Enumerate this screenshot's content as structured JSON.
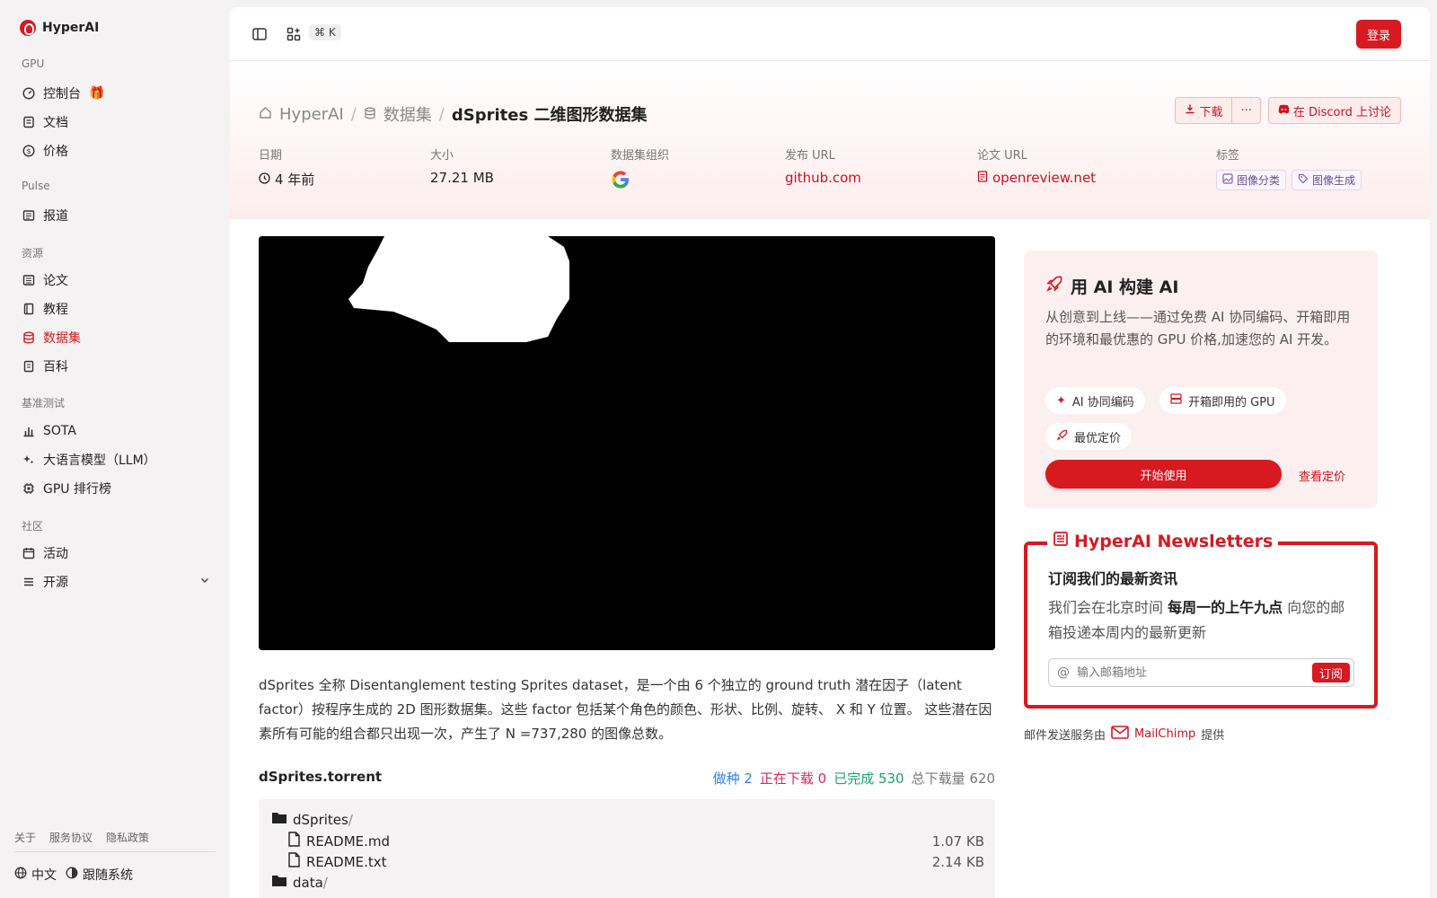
{
  "brand": {
    "name": "HyperAI"
  },
  "sidebar": {
    "sections": [
      {
        "label": "GPU"
      },
      {
        "label": "Pulse"
      },
      {
        "label": "资源"
      },
      {
        "label": "基准测试"
      },
      {
        "label": "社区"
      }
    ],
    "items": [
      {
        "label": "控制台"
      },
      {
        "label": "文档"
      },
      {
        "label": "价格"
      },
      {
        "label": "报道"
      },
      {
        "label": "论文"
      },
      {
        "label": "教程"
      },
      {
        "label": "数据集"
      },
      {
        "label": "百科"
      },
      {
        "label": "SOTA"
      },
      {
        "label": "大语言模型（LLM）"
      },
      {
        "label": "GPU 排行榜"
      },
      {
        "label": "活动"
      },
      {
        "label": "开源"
      }
    ],
    "footer_links": [
      "关于",
      "服务协议",
      "隐私政策"
    ],
    "language": "中文",
    "tracking": "跟随系统"
  },
  "topbar": {
    "shortcut": "⌘ K",
    "login": "登录"
  },
  "breadcrumb": {
    "home": "HyperAI",
    "section": "数据集",
    "current": "dSprites 二维图形数据集"
  },
  "actions": {
    "download": "下载",
    "more": "···",
    "discord": "在 Discord 上讨论"
  },
  "meta": {
    "date_label": "日期",
    "date_value": "4 年前",
    "size_label": "大小",
    "size_value": "27.21 MB",
    "org_label": "数据集组织",
    "release_label": "发布 URL",
    "release_value": "github.com",
    "paper_label": "论文 URL",
    "paper_value": "openreview.net",
    "tags_label": "标签",
    "tags": [
      "图像分类",
      "图像生成"
    ]
  },
  "description": "dSprites 全称 Disentanglement testing Sprites dataset，是一个由 6 个独立的 ground truth 潜在因子（latent factor）按程序生成的 2D 图形数据集。这些 factor 包括某个角色的颜色、形状、比例、旋转、 X 和 Y 位置。 这些潜在因素所有可能的组合都只出现一次，产生了 N =737,280 的图像总数。",
  "torrent": {
    "title": "dSprites.torrent",
    "seeds": "做种 2",
    "downloading": "正在下载 0",
    "completed": "已完成 530",
    "total": "总下载量 620",
    "files": [
      {
        "name": "dSprites",
        "suffix": "/",
        "size": ""
      },
      {
        "name": "README.md",
        "suffix": "",
        "size": "1.07 KB"
      },
      {
        "name": "README.txt",
        "suffix": "",
        "size": "2.14 KB"
      },
      {
        "name": "data",
        "suffix": "/",
        "size": ""
      }
    ]
  },
  "promo": {
    "title": "用 AI 构建 AI",
    "text": "从创意到上线——通过免费 AI 协同编码、开箱即用的环境和最优惠的 GPU 价格,加速您的 AI 开发。",
    "chips": [
      "AI 协同编码",
      "开箱即用的 GPU",
      "最优定价"
    ],
    "start": "开始使用",
    "pricing": "查看定价"
  },
  "newsletter": {
    "title": "HyperAI Newsletters",
    "heading": "订阅我们的最新资讯",
    "text_pre": "我们会在北京时间 ",
    "text_bold": "每周一的上午九点",
    "text_post": " 向您的邮箱投递本周内的最新更新",
    "placeholder": "输入邮箱地址",
    "subscribe": "订阅"
  },
  "mailchimp": {
    "pre": "邮件发送服务由",
    "link": "MailChimp",
    "post": "提供"
  },
  "colors": {
    "accent": "#d71920",
    "seed": "#2f80ed",
    "downloading": "#e0245e",
    "completed": "#1aa567"
  }
}
